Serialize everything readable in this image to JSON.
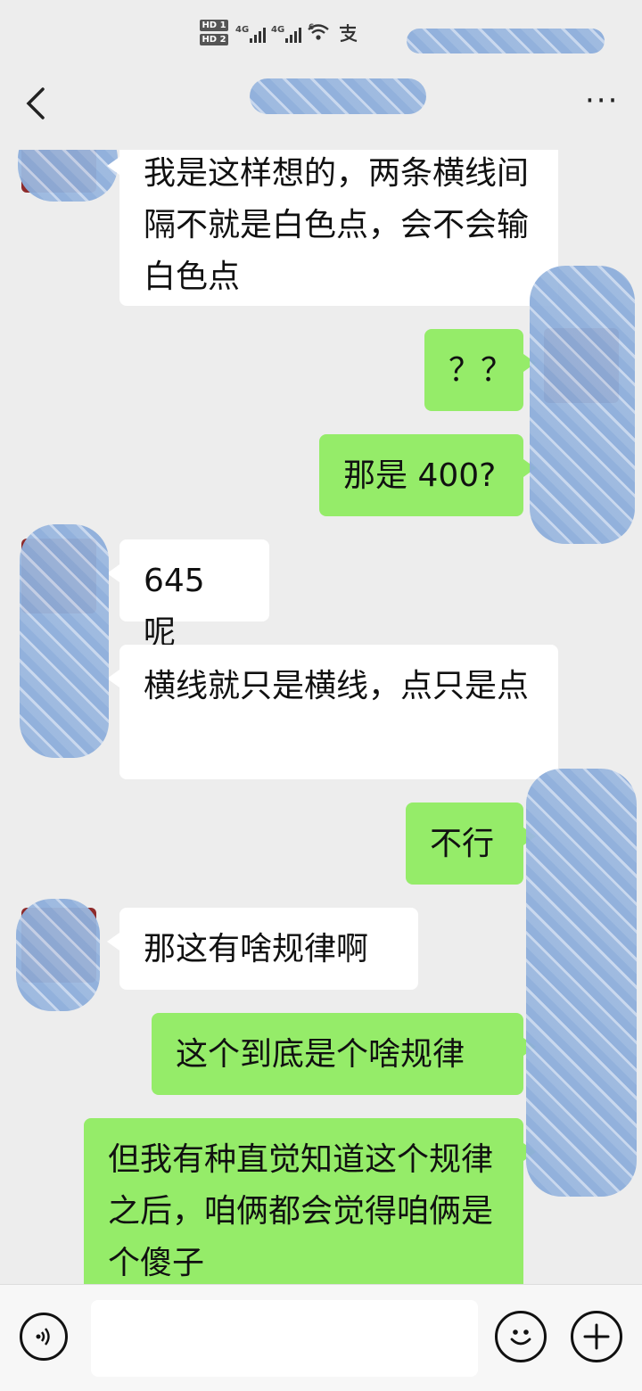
{
  "status_bar": {
    "hd1": "HD 1",
    "hd2": "HD 2",
    "net1": "4G",
    "net2": "4G",
    "wifi_badge": "6",
    "icons": [
      "signal-icon",
      "wifi-icon",
      "alipay-icon",
      "battery-icon"
    ]
  },
  "header": {
    "back_icon": "chevron-left-icon",
    "more_icon": "more-dots-icon",
    "more_glyph": "···"
  },
  "messages": [
    {
      "side": "left",
      "text": "我是这样想的，两条横线间隔不就是白色点，会不会输白色点"
    },
    {
      "side": "right",
      "text": "？？"
    },
    {
      "side": "right",
      "text": "那是 400?"
    },
    {
      "side": "left",
      "text": "645 呢"
    },
    {
      "side": "left",
      "text": "横线就只是横线，点只是点"
    },
    {
      "side": "right",
      "text": "不行"
    },
    {
      "side": "left",
      "text": "那这有啥规律啊"
    },
    {
      "side": "right",
      "text": "这个到底是个啥规律"
    },
    {
      "side": "right",
      "text": "但我有种直觉知道这个规律之后，咱俩都会觉得咱俩是个傻子"
    }
  ],
  "input_bar": {
    "voice_icon": "voice-icon",
    "emoji_icon": "emoji-icon",
    "plus_icon": "plus-icon",
    "voice_glyph": "🔊",
    "emoji_glyph": "☺",
    "plus_glyph": "+"
  },
  "colors": {
    "background": "#ededed",
    "sent_bubble": "#95ec69",
    "received_bubble": "#ffffff"
  }
}
